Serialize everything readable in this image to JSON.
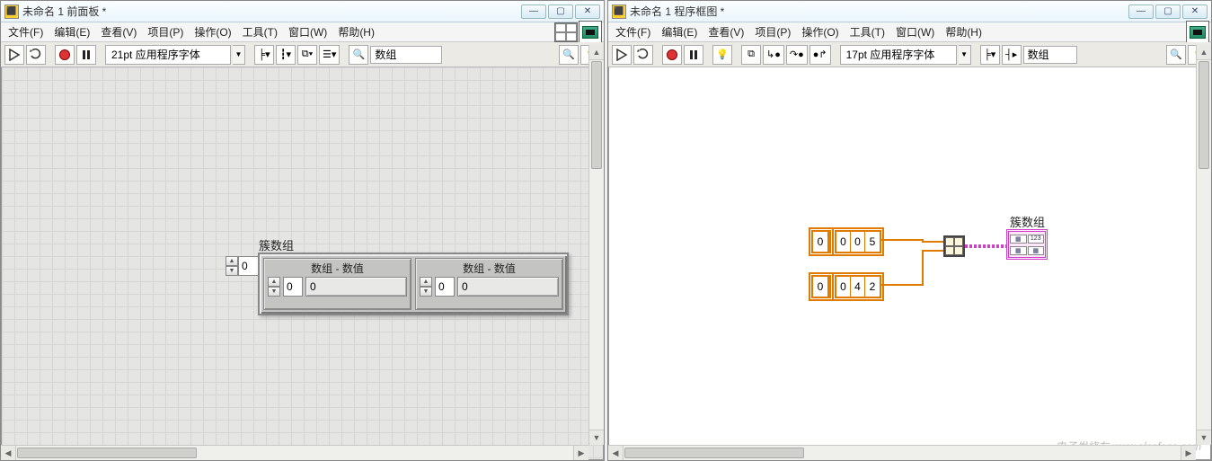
{
  "front_panel": {
    "title": "未命名 1 前面板 *",
    "menus": [
      "文件(F)",
      "编辑(E)",
      "查看(V)",
      "项目(P)",
      "操作(O)",
      "工具(T)",
      "窗口(W)",
      "帮助(H)"
    ],
    "font_label": "21pt 应用程序字体",
    "search_placeholder": "数组",
    "cluster_label": "簇数组",
    "index_value": "0",
    "arrays": [
      {
        "caption": "数组 - 数值",
        "index": "0",
        "value": "0"
      },
      {
        "caption": "数组 - 数值",
        "index": "0",
        "value": "0"
      }
    ]
  },
  "block_diagram": {
    "title": "未命名 1 程序框图 *",
    "menus": [
      "文件(F)",
      "编辑(E)",
      "查看(V)",
      "项目(P)",
      "操作(O)",
      "工具(T)",
      "窗口(W)",
      "帮助(H)"
    ],
    "font_label": "17pt 应用程序字体",
    "search_placeholder": "数组",
    "array1": {
      "index": "0",
      "cells": [
        "0",
        "0",
        "5"
      ]
    },
    "array2": {
      "index": "0",
      "cells": [
        "0",
        "4",
        "2"
      ]
    },
    "indicator_label": "簇数组"
  },
  "watermark": "电子发烧友  www.elecfans.com"
}
